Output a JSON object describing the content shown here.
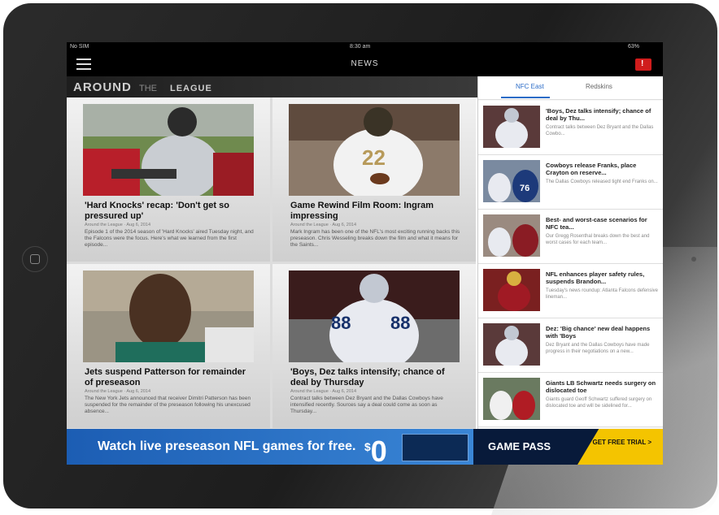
{
  "status_bar": {
    "carrier": "No SIM",
    "time": "8:30 am",
    "battery": "63%"
  },
  "app_bar": {
    "title": "NEWS"
  },
  "section": {
    "brand_primary": "AROUND",
    "brand_secondary": "THE",
    "brand_tertiary": "LEAGUE"
  },
  "articles": [
    {
      "headline": "'Hard Knocks' recap: 'Don't get so pressured up'",
      "byline": "Around the League · Aug 6, 2014",
      "summary": "Episode 1 of the 2014 season of 'Hard Knocks' aired Tuesday night, and the Falcons were the focus. Here's what we learned from the first episode..."
    },
    {
      "headline": "Game Rewind Film Room: Ingram impressing",
      "byline": "Around the League · Aug 6, 2014",
      "summary": "Mark Ingram has been one of the NFL's most exciting running backs this preseason. Chris Wesseling breaks down the film and what it means for the Saints..."
    },
    {
      "headline": "Jets suspend Patterson for remainder of preseason",
      "byline": "Around the League · Aug 6, 2014",
      "summary": "The New York Jets announced that receiver Dimitri Patterson has been suspended for the remainder of the preseason following his unexcused absence..."
    },
    {
      "headline": "'Boys, Dez talks intensify; chance of deal by Thursday",
      "byline": "Around the League · Aug 6, 2014",
      "summary": "Contract talks between Dez Bryant and the Dallas Cowboys have intensified recently. Sources say a deal could come as soon as Thursday..."
    }
  ],
  "sidebar": {
    "tabs": [
      {
        "label": "NFC East"
      },
      {
        "label": "Redskins"
      }
    ],
    "items": [
      {
        "title": "'Boys, Dez talks intensify; chance of deal by Thu...",
        "summary": "Contract talks between Dez Bryant and the Dallas Cowbo..."
      },
      {
        "title": "Cowboys release Franks, place Crayton on reserve...",
        "summary": "The Dallas Cowboys released tight end Franks on..."
      },
      {
        "title": "Best- and worst-case scenarios for NFC tea...",
        "summary": "Our Gregg Rosenthal breaks down the best and worst cases for each team..."
      },
      {
        "title": "NFL enhances player safety rules, suspends Brandon...",
        "summary": "Tuesday's news roundup: Atlanta Falcons defensive lineman..."
      },
      {
        "title": "Dez: 'Big chance' new deal happens with 'Boys",
        "summary": "Dez Bryant and the Dallas Cowboys have made progress in their negotiations on a new..."
      },
      {
        "title": "Giants LB Schwartz needs surgery on dislocated toe",
        "summary": "Giants guard Geoff Schwartz suffered surgery on dislocated toe and will be sidelined for..."
      }
    ]
  },
  "banner": {
    "promo_text": "Watch live preseason NFL games for free.",
    "price_symbol": "$",
    "price_value": "0",
    "product_name": "GAME PASS",
    "cta": "GET FREE TRIAL >"
  },
  "colors": {
    "accent": "#2b6cc7",
    "alert": "#d01c1c",
    "banner_blue": "#1c5db3",
    "cta_yellow": "#f4c400"
  }
}
